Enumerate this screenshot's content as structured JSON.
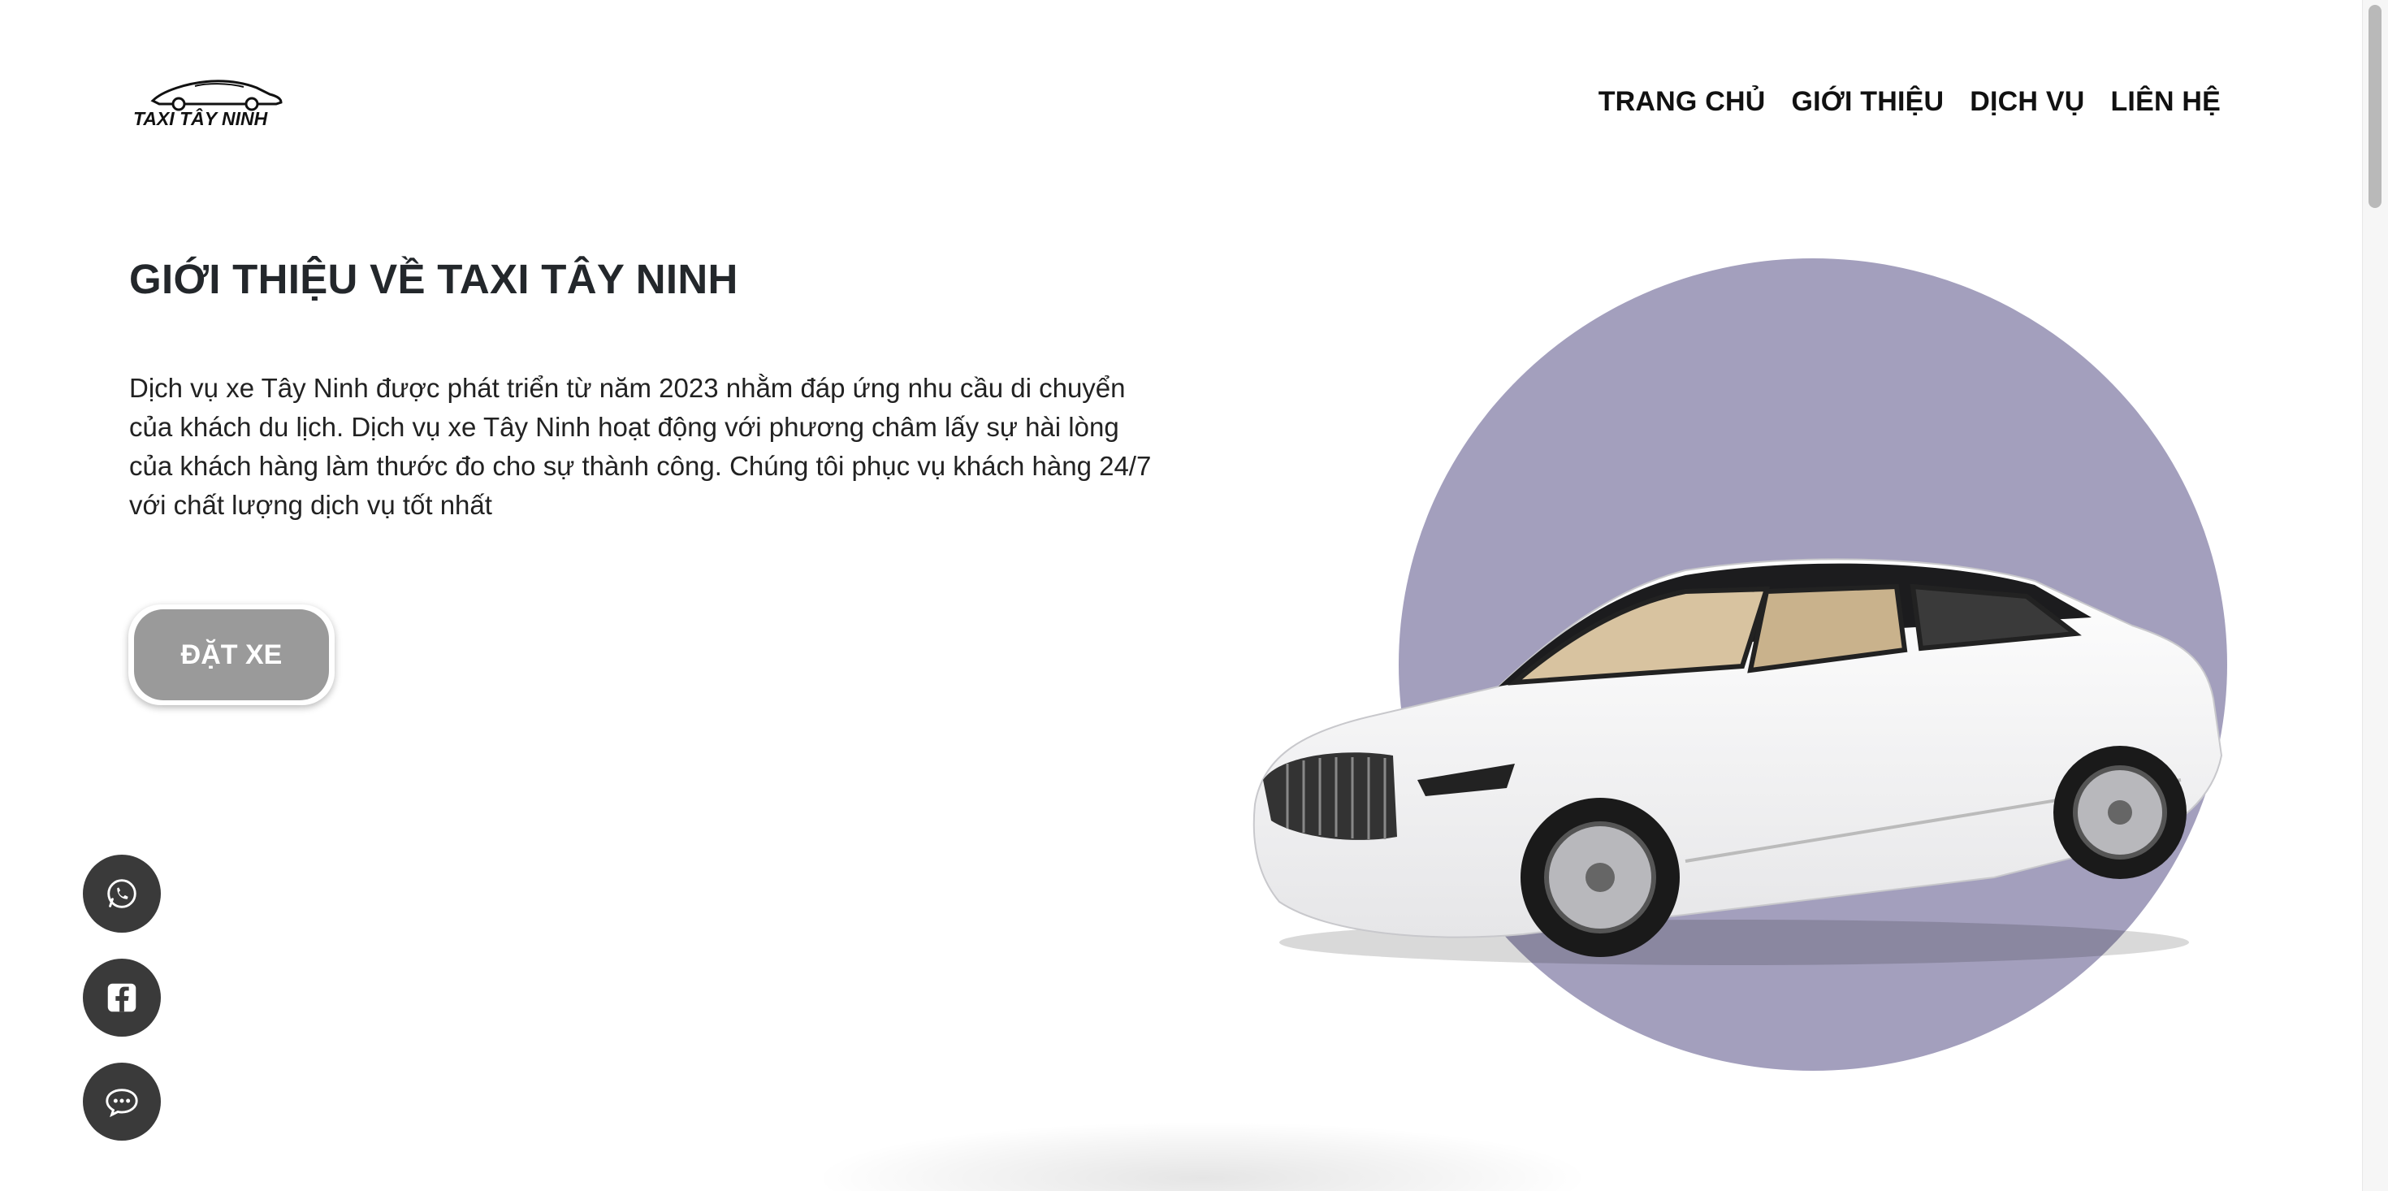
{
  "header": {
    "logo_text": "TAXI TÂY NINH",
    "nav": [
      {
        "label": "TRANG CHỦ"
      },
      {
        "label": "GIỚI THIỆU"
      },
      {
        "label": "DỊCH VỤ"
      },
      {
        "label": "LIÊN HỆ"
      }
    ]
  },
  "hero": {
    "title": "GIỚI THIỆU VỀ TAXI TÂY NINH",
    "description": "Dịch vụ xe Tây Ninh được phát triển từ năm 2023 nhằm đáp ứng nhu cầu di chuyển của khách du lịch. Dịch vụ xe Tây Ninh hoạt động với phương châm lấy sự hài lòng của khách hàng làm thước đo cho sự thành công. Chúng tôi phục vụ khách hàng 24/7 với chất lượng dịch vụ tốt nhất",
    "cta_label": "ĐẶT XE",
    "image": "white luxury sedan on lavender circle",
    "circle_color": "#a39fbd"
  },
  "floating": [
    {
      "icon": "whatsapp-icon"
    },
    {
      "icon": "facebook-icon"
    },
    {
      "icon": "chat-icon"
    }
  ],
  "colors": {
    "text": "#1f2328",
    "button": "#9a9a9a",
    "floating_button": "#3a3a3a"
  }
}
